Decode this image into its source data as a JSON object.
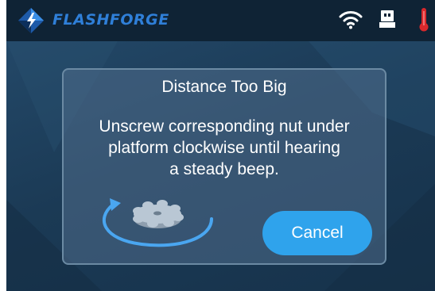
{
  "header": {
    "brand": "FLASHFORGE",
    "icons": [
      "flashforge-logo-icon",
      "wifi-icon",
      "usb-icon",
      "thermometer-icon"
    ]
  },
  "dialog": {
    "title": "Distance Too Big",
    "message_lines": [
      "Unscrew corresponding nut under",
      "platform clockwise until hearing",
      "a steady beep."
    ],
    "cancel_label": "Cancel",
    "illustration_icons": [
      "rotate-arrow-icon",
      "nut-icon"
    ]
  },
  "colors": {
    "brand": "#2f7fd8",
    "header_bg": "#0f2335",
    "screen_bg": "#1d3a52",
    "button": "#2fa3ec",
    "thermometer": "#d8282c"
  }
}
